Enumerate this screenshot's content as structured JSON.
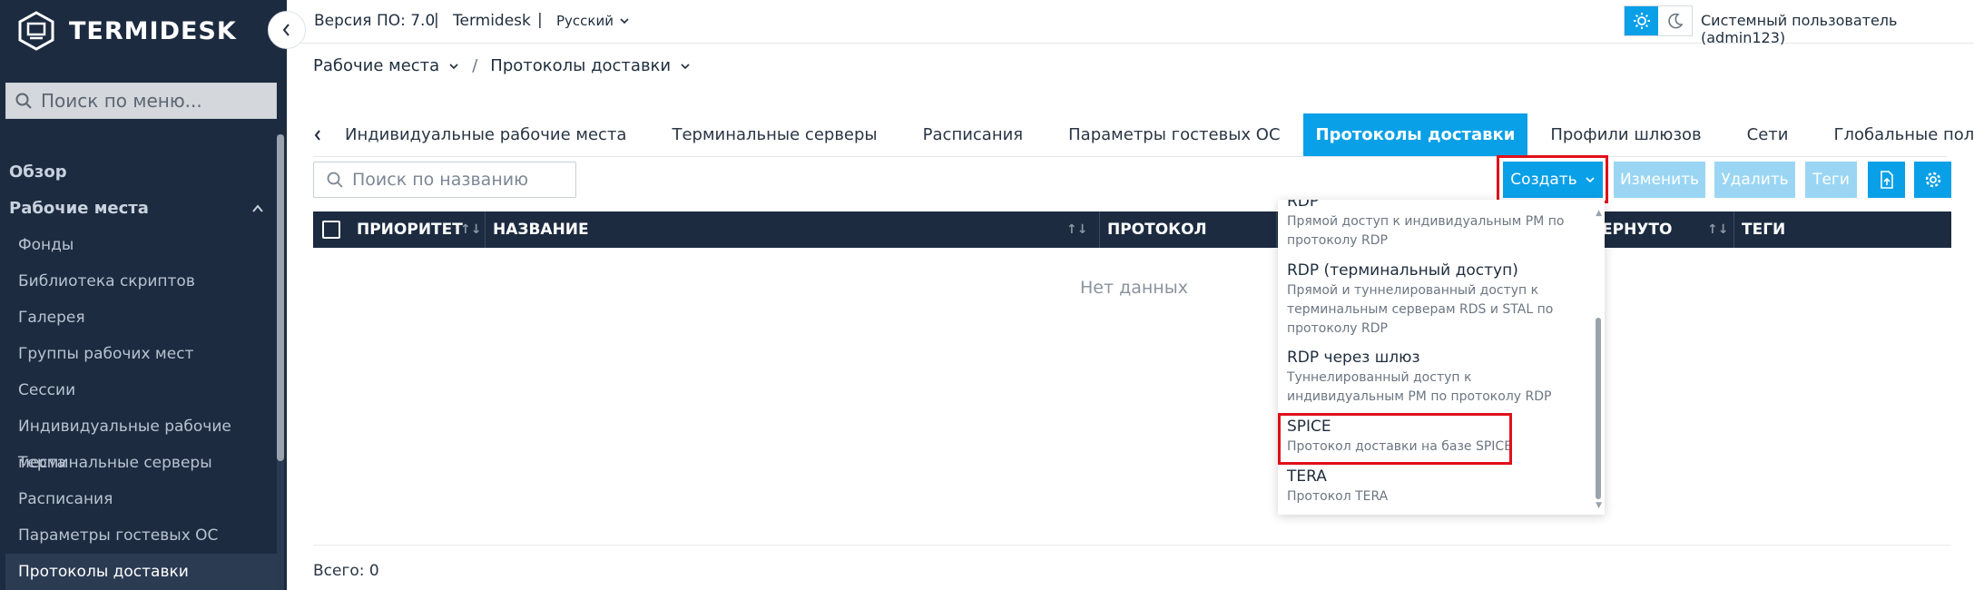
{
  "app": {
    "logo_text": "TERMIDESK",
    "version": "Версия ПО: 7.0",
    "name": "Termidesk",
    "language": "Русский",
    "user": "Системный пользователь (admin123)"
  },
  "sidebar": {
    "search_placeholder": "Поиск по меню...",
    "overview": "Обзор",
    "section": "Рабочие места",
    "items": [
      {
        "label": "Фонды"
      },
      {
        "label": "Библиотека скриптов"
      },
      {
        "label": "Галерея"
      },
      {
        "label": "Группы рабочих мест"
      },
      {
        "label": "Сессии"
      },
      {
        "label": "Индивидуальные рабочие места"
      },
      {
        "label": "Терминальные серверы"
      },
      {
        "label": "Расписания"
      },
      {
        "label": "Параметры гостевых ОС"
      },
      {
        "label": "Протоколы доставки"
      }
    ]
  },
  "breadcrumbs": {
    "first": "Рабочие места",
    "second": "Протоколы доставки"
  },
  "tabs": [
    {
      "label": "Индивидуальные рабочие места"
    },
    {
      "label": "Терминальные серверы"
    },
    {
      "label": "Расписания"
    },
    {
      "label": "Параметры гостевых ОС"
    },
    {
      "label": "Протоколы доставки"
    },
    {
      "label": "Профили шлюзов"
    },
    {
      "label": "Сети"
    },
    {
      "label": "Глобальные политики"
    }
  ],
  "toolbar": {
    "search_placeholder": "Поиск по названию",
    "create": "Создать",
    "edit": "Изменить",
    "delete": "Удалить",
    "tags": "Теги"
  },
  "table": {
    "columns": {
      "priority": "ПРИОРИТЕТ",
      "name": "НАЗВАНИЕ",
      "protocol": "ПРОТОКОЛ",
      "collapsed": "ЕРНУТО",
      "tags": "ТЕГИ"
    },
    "empty": "Нет данных",
    "total": "Всего: 0"
  },
  "dropdown": {
    "items": [
      {
        "title": "RDP",
        "desc": "Прямой доступ к индивидуальным РМ по протоколу RDP"
      },
      {
        "title": "RDP (терминальный доступ)",
        "desc": "Прямой и туннелированный доступ к терминальным серверам RDS и STAL по протоколу RDP"
      },
      {
        "title": "RDP через шлюз",
        "desc": "Туннелированный доступ к индивидуальным РМ по протоколу RDP"
      },
      {
        "title": "SPICE",
        "desc": "Протокол доставки на базе SPICE"
      },
      {
        "title": "TERA",
        "desc": "Протокол TERA"
      }
    ]
  },
  "colors": {
    "sidebar_bg": "#1c2b40",
    "accent": "#0aa0e8",
    "highlight": "#e0101a"
  }
}
